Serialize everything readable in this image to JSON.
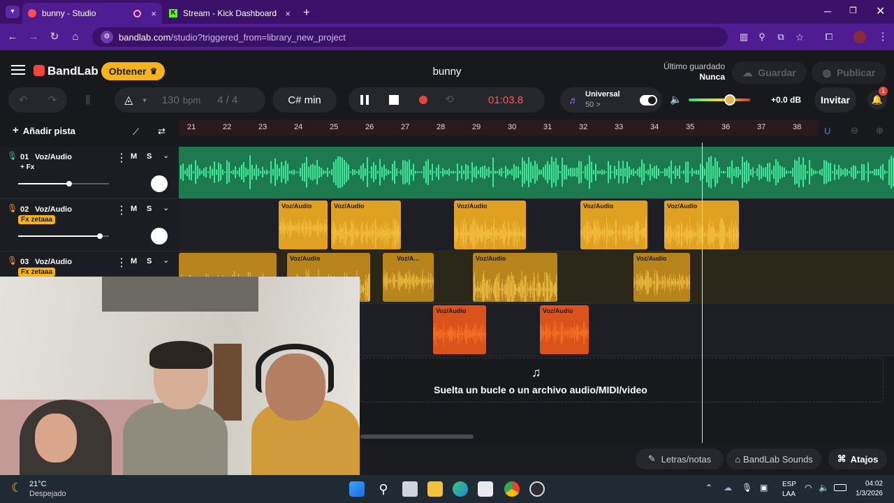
{
  "browser": {
    "tabs": [
      {
        "label": "bunny - Studio",
        "close": "×"
      },
      {
        "label": "Stream - Kick Dashboard",
        "close": "×"
      }
    ],
    "new_tab": "+",
    "url_host": "bandlab.com",
    "url_path": "/studio?triggered_from=library_new_project"
  },
  "studio": {
    "logo": "BandLab",
    "get_button": "Obtener",
    "project_title": "bunny",
    "last_saved_label": "Último guardado",
    "last_saved_value": "Nunca",
    "save_button": "Guardar",
    "publish_button": "Publicar",
    "invite_button": "Invitar",
    "notification_count": "1"
  },
  "toolbar": {
    "bpm_value": "130",
    "bpm_unit": "bpm",
    "time_sig": "4 / 4",
    "key": "C# min",
    "time": "01:03.8",
    "universal_label": "Universal",
    "universal_value": "50 >",
    "volume": "+0.0 dB"
  },
  "tracks_panel": {
    "add_track": "Añadir pista",
    "ruler": [
      "21",
      "22",
      "23",
      "24",
      "25",
      "26",
      "27",
      "28",
      "29",
      "30",
      "31",
      "32",
      "33",
      "34",
      "35",
      "36",
      "37",
      "38"
    ]
  },
  "tracks": [
    {
      "num": "01",
      "name": "Voz/Audio",
      "fx": "+ Fx",
      "mute": "M",
      "solo": "S",
      "vol": 0.56
    },
    {
      "num": "02",
      "name": "Voz/Audio",
      "fx": "Fx zetaaa",
      "mute": "M",
      "solo": "S",
      "vol": 0.9
    },
    {
      "num": "03",
      "name": "Voz/Audio",
      "fx": "Fx zetaaa",
      "mute": "M",
      "solo": "S"
    }
  ],
  "clips": {
    "track2": [
      "Voz/Audio",
      "Voz/Audio",
      "Voz/Audio",
      "Voz/Audio",
      "Voz/Audio"
    ],
    "track3": [
      "Voz/Audio",
      "Voz/A...",
      "Voz/Audio",
      "Voz/Audio"
    ],
    "track4": [
      "Voz/Audio",
      "Voz/Audio"
    ]
  },
  "drop_zone": "Suelta un bucle o un archivo audio/MIDI/video",
  "bottom": {
    "lyrics": "Letras/notas",
    "sounds": "BandLab Sounds",
    "shortcuts": "Atajos"
  },
  "taskbar": {
    "weather_temp": "21°C",
    "weather_desc": "Despejado",
    "lang": "ESP",
    "region": "LAA",
    "time": "04:02",
    "date": "1/3/2026"
  },
  "colors": {
    "browser_purple": "#4f1c92",
    "accent_green": "#2fd487",
    "accent_orange": "#f5a623",
    "accent_red": "#ff5a4e",
    "get_button": "#f6b41c"
  }
}
